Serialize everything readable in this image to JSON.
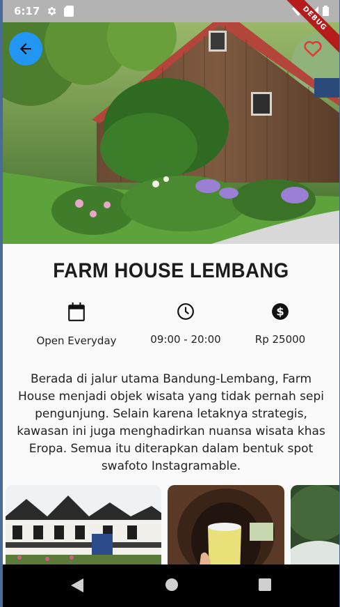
{
  "status_bar": {
    "time": "6:17",
    "debug_label": "DEBUG"
  },
  "place": {
    "name": "FARM HOUSE LEMBANG",
    "info": [
      {
        "icon": "calendar-icon",
        "label": "Open Everyday"
      },
      {
        "icon": "clock-icon",
        "label": "09:00 - 20:00"
      },
      {
        "icon": "dollar-icon",
        "label": "Rp 25000"
      }
    ],
    "description": "Berada di jalur utama Bandung-Lembang, Farm House menjadi objek wisata yang tidak pernah sepi pengunjung. Selain karena letaknya strategis, kawasan ini juga menghadirkan nuansa wisata khas Eropa. Semua itu diterapkan dalam bentuk spot swafoto Instagramable."
  },
  "colors": {
    "accent": "#2196f3",
    "favorite": "#e53935",
    "status_bar": "#b3b3b3",
    "nav_bar": "#000000"
  }
}
